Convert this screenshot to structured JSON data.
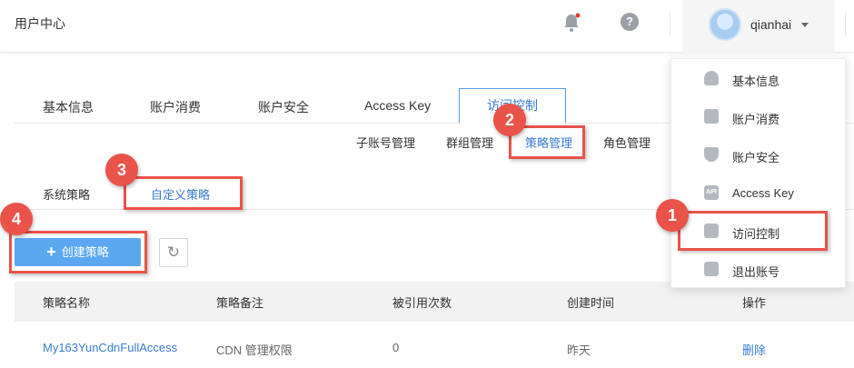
{
  "header": {
    "app_title": "用户中心",
    "username": "qianhai",
    "icons": {
      "bell": "bell-icon",
      "help": "help-icon",
      "help_glyph": "?"
    }
  },
  "main_tabs": [
    "基本信息",
    "账户消费",
    "账户安全",
    "Access Key",
    "访问控制"
  ],
  "sub_tabs": [
    "子账号管理",
    "群组管理",
    "策略管理",
    "角色管理"
  ],
  "policy_tabs": [
    "系统策略",
    "自定义策略"
  ],
  "toolbar": {
    "create_icon": "+",
    "create_label": "创建策略",
    "refresh_glyph": "↻"
  },
  "table": {
    "headers": [
      "策略名称",
      "策略备注",
      "被引用次数",
      "创建时间",
      "操作"
    ],
    "rows": [
      {
        "name": "My163YunCdnFullAccess",
        "note": "CDN 管理权限",
        "refs": "0",
        "created": "昨天",
        "action": "删除"
      }
    ]
  },
  "user_menu": {
    "items": [
      {
        "label": "基本信息",
        "icon": "user-icon"
      },
      {
        "label": "账户消费",
        "icon": "wallet-icon"
      },
      {
        "label": "账户安全",
        "icon": "shield-icon"
      },
      {
        "label": "Access Key",
        "icon": "api-icon",
        "icon_text": "API"
      },
      {
        "label": "访问控制",
        "icon": "folder-user-icon"
      },
      {
        "label": "退出账号",
        "icon": "logout-icon"
      }
    ]
  },
  "annotations": {
    "steps": [
      "1",
      "2",
      "3",
      "4"
    ],
    "highlight_color": "#e9534a"
  },
  "colors": {
    "accent": "#3a7bd5",
    "button": "#5ba7f0"
  }
}
